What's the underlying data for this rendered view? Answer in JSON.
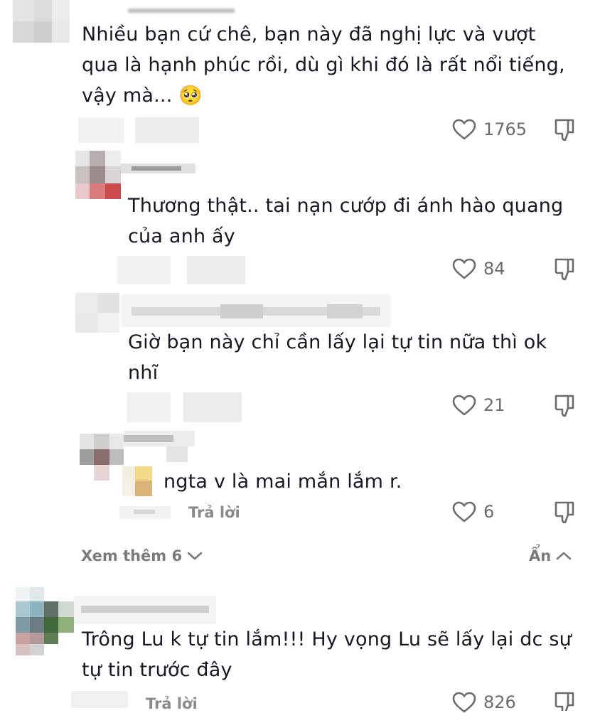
{
  "comments": [
    {
      "text_lines": [
        "Nhiều bạn cứ chê, bạn này đã nghị lực và vượt",
        "qua là hạnh phúc rồi, dù gì khi đó là rất nổi tiếng,",
        "vậy mà..."
      ],
      "emoji": "🥺",
      "likes": "1765"
    },
    {
      "text_lines": [
        "Thương thật.. tai nạn cướp đi ánh hào quang",
        "của anh ấy"
      ],
      "likes": "84"
    },
    {
      "text_lines": [
        "Giờ bạn này chỉ cần lấy lại tự tin nữa thì ok",
        "nhĩ"
      ],
      "likes": "21"
    },
    {
      "text_lines": [
        "ngta v là mai mắn lắm r."
      ],
      "reply_label": "Trả lời",
      "likes": "6"
    },
    {
      "text_lines": [
        "Trông Lu k tự tin lắm!!! Hy vọng Lu sẽ lấy lại dc sự",
        "tự tin trước đây"
      ],
      "reply_label": "Trả lời",
      "likes": "826"
    }
  ],
  "view_more_label": "Xem thêm 6",
  "hide_label": "Ẩn",
  "icons": {
    "like": "heart-outline-icon",
    "dislike": "thumbs-down-icon",
    "expand": "chevron-down-icon",
    "collapse": "chevron-up-icon"
  },
  "colors": {
    "text": "#161823",
    "muted": "#7a7a7a"
  }
}
